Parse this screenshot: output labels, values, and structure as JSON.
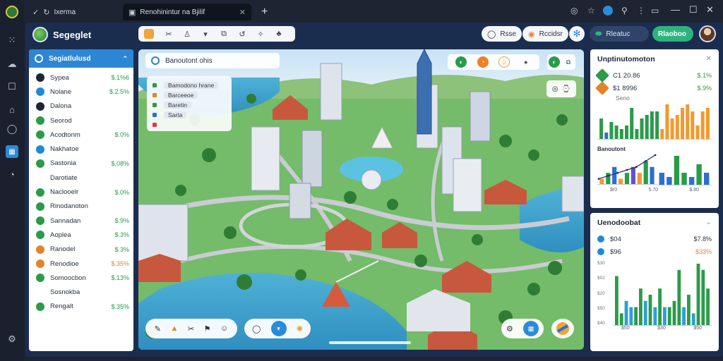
{
  "browser": {
    "tabs": [
      {
        "label": "Ixerma",
        "active": false
      },
      {
        "label": "Renohinintur na Bjilif",
        "active": true
      }
    ],
    "new_tab_label": "+"
  },
  "app": {
    "brand": "Segeglet",
    "header_pills": [
      {
        "label": "Rsse"
      },
      {
        "label": "Rccidsr"
      },
      {
        "label": "Rleatuc"
      },
      {
        "label": "Rlaoboo"
      }
    ]
  },
  "left_panel": {
    "title": "Segiatlulusd",
    "items": [
      {
        "label": "Sypea",
        "value": "$.1%6",
        "icon_color": "#1d2433",
        "value_tone": "green"
      },
      {
        "label": "Nolane",
        "value": "$.2.5%",
        "icon_color": "#1f8ad6",
        "value_tone": "green"
      },
      {
        "label": "Dalona",
        "value": "",
        "icon_color": "#1d2433",
        "value_tone": "green"
      },
      {
        "label": "Seorod",
        "value": "",
        "icon_color": "#2a9b4a",
        "value_tone": "green"
      },
      {
        "label": "Acodtonm",
        "value": "$.0%",
        "icon_color": "#2a9b4a",
        "value_tone": "green"
      },
      {
        "label": "Nakhatoe",
        "value": "",
        "icon_color": "#1f8ad6",
        "value_tone": "green"
      },
      {
        "label": "Sastonia",
        "value": "$.08%",
        "icon_color": "#2a9b4a",
        "value_tone": "green"
      },
      {
        "label": "Darotiate",
        "value": "",
        "icon_color": "#ffffff",
        "value_tone": "green"
      },
      {
        "label": "Naclooelr",
        "value": "$.0%",
        "icon_color": "#2a9b4a",
        "value_tone": "green"
      },
      {
        "label": "Rinodanoton",
        "value": "",
        "icon_color": "#2a9b4a",
        "value_tone": "green"
      },
      {
        "label": "Sannadan",
        "value": "$.9%",
        "icon_color": "#2a9b4a",
        "value_tone": "green"
      },
      {
        "label": "Aoplea",
        "value": "$.3%",
        "icon_color": "#2a9b4a",
        "value_tone": "green"
      },
      {
        "label": "Ranodel",
        "value": "$.3%",
        "icon_color": "#e1842d",
        "value_tone": "green"
      },
      {
        "label": "Renodioe",
        "value": "$.35%",
        "icon_color": "#e1842d",
        "value_tone": "orange"
      },
      {
        "label": "Somoocbon",
        "value": "$.13%",
        "icon_color": "#2a9b4a",
        "value_tone": "green"
      },
      {
        "label": "Sosnokba",
        "value": "",
        "icon_color": "#ffffff",
        "value_tone": "green"
      },
      {
        "label": "Rengalt",
        "value": "$.35%",
        "icon_color": "#2a9b4a",
        "value_tone": "green"
      }
    ]
  },
  "map": {
    "search_label": "Banoutont ohis",
    "legend": [
      {
        "label": "Bamodono hrane",
        "color": "#2a9b4a"
      },
      {
        "label": "Barceeoe",
        "color": "#e1842d"
      },
      {
        "label": "Baretin",
        "color": "#2a9b4a"
      },
      {
        "label": "Sarta",
        "color": "#2d6fd0"
      },
      {
        "label": "",
        "color": "#e03a3a"
      }
    ]
  },
  "right_top": {
    "title": "Unptinutomoton",
    "rows": [
      {
        "label": "C1 20.86",
        "value": "$.1%",
        "color": "#2a9b4a",
        "value_tone": "green"
      },
      {
        "label": "$1 8996",
        "value": "$.9%",
        "color": "#e1842d",
        "value_tone": "green"
      }
    ],
    "sub_label": "Seno",
    "chart_label": "Banoutont",
    "x_labels": [
      "$r0",
      "5.70",
      "$.80"
    ]
  },
  "right_bottom": {
    "title": "Uenodoobat",
    "rows": [
      {
        "label": "$04",
        "value": "$7.8%",
        "color": "#1f8ad6",
        "value_tone": "dark"
      },
      {
        "label": "$96",
        "value": "$33%",
        "color": "#1f8ad6",
        "value_tone": "orange"
      }
    ],
    "y_labels": [
      "$30",
      "$02",
      "$20",
      "$50",
      "$40"
    ],
    "x_labels": [
      "$50",
      "$30",
      "$50"
    ]
  },
  "chart_data": [
    {
      "type": "bar",
      "name": "top-panel-bars",
      "title": "",
      "values": [
        6,
        2,
        5,
        4,
        3,
        4,
        9,
        3,
        6,
        7,
        8,
        8,
        3,
        10,
        6,
        7,
        9,
        10,
        8,
        4,
        8,
        9
      ],
      "colors": [
        "#2a9b4a",
        "#2d6fd0",
        "#2a9b4a",
        "#2a9b4a",
        "#2a9b4a",
        "#2a9b4a",
        "#2a9b4a",
        "#2a9b4a",
        "#2a9b4a",
        "#2a9b4a",
        "#2a9b4a",
        "#2a9b4a",
        "#f2992e",
        "#f2992e",
        "#f2992e",
        "#f2992e",
        "#f2992e",
        "#f2992e",
        "#f2992e",
        "#f2992e",
        "#f2992e",
        "#f2992e"
      ]
    },
    {
      "type": "bar",
      "name": "middle-left-combo",
      "title": "Banoutont",
      "values": [
        1,
        2,
        3,
        1,
        2,
        3,
        2,
        4,
        3
      ],
      "line": [
        1,
        1.5,
        2,
        2.5,
        3,
        4,
        5
      ],
      "colors": [
        "#f2992e",
        "#2a9b4a",
        "#2d6fd0",
        "#f2992e",
        "#2a9b4a",
        "#6b4fc8",
        "#f2992e",
        "#2a9b4a",
        "#2d6fd0"
      ]
    },
    {
      "type": "bar",
      "name": "middle-right-bars",
      "title": "",
      "values": [
        3,
        2,
        7,
        3,
        2,
        5,
        3
      ],
      "colors": [
        "#2d6fd0",
        "#2d6fd0",
        "#2a9b4a",
        "#2a9b4a",
        "#2d6fd0",
        "#2a9b4a",
        "#2d6fd0"
      ]
    },
    {
      "type": "bar",
      "name": "bottom-panel-bars",
      "title": "",
      "values": [
        8,
        2,
        4,
        3,
        3,
        6,
        4,
        5,
        3,
        6,
        3,
        3,
        4,
        9,
        3,
        5,
        2,
        10,
        9,
        6
      ],
      "colors": [
        "#2a9b4a",
        "#2a9b4a",
        "#2d9ed6",
        "#2d9ed6",
        "#2a9b4a",
        "#2a9b4a",
        "#2d9ed6",
        "#2a9b4a",
        "#2d9ed6",
        "#2a9b4a",
        "#2d9ed6",
        "#2a9b4a",
        "#2a9b4a",
        "#2a9b4a",
        "#2d9ed6",
        "#2a9b4a",
        "#2d9ed6",
        "#2a9b4a",
        "#2a9b4a",
        "#2a9b4a"
      ]
    }
  ]
}
